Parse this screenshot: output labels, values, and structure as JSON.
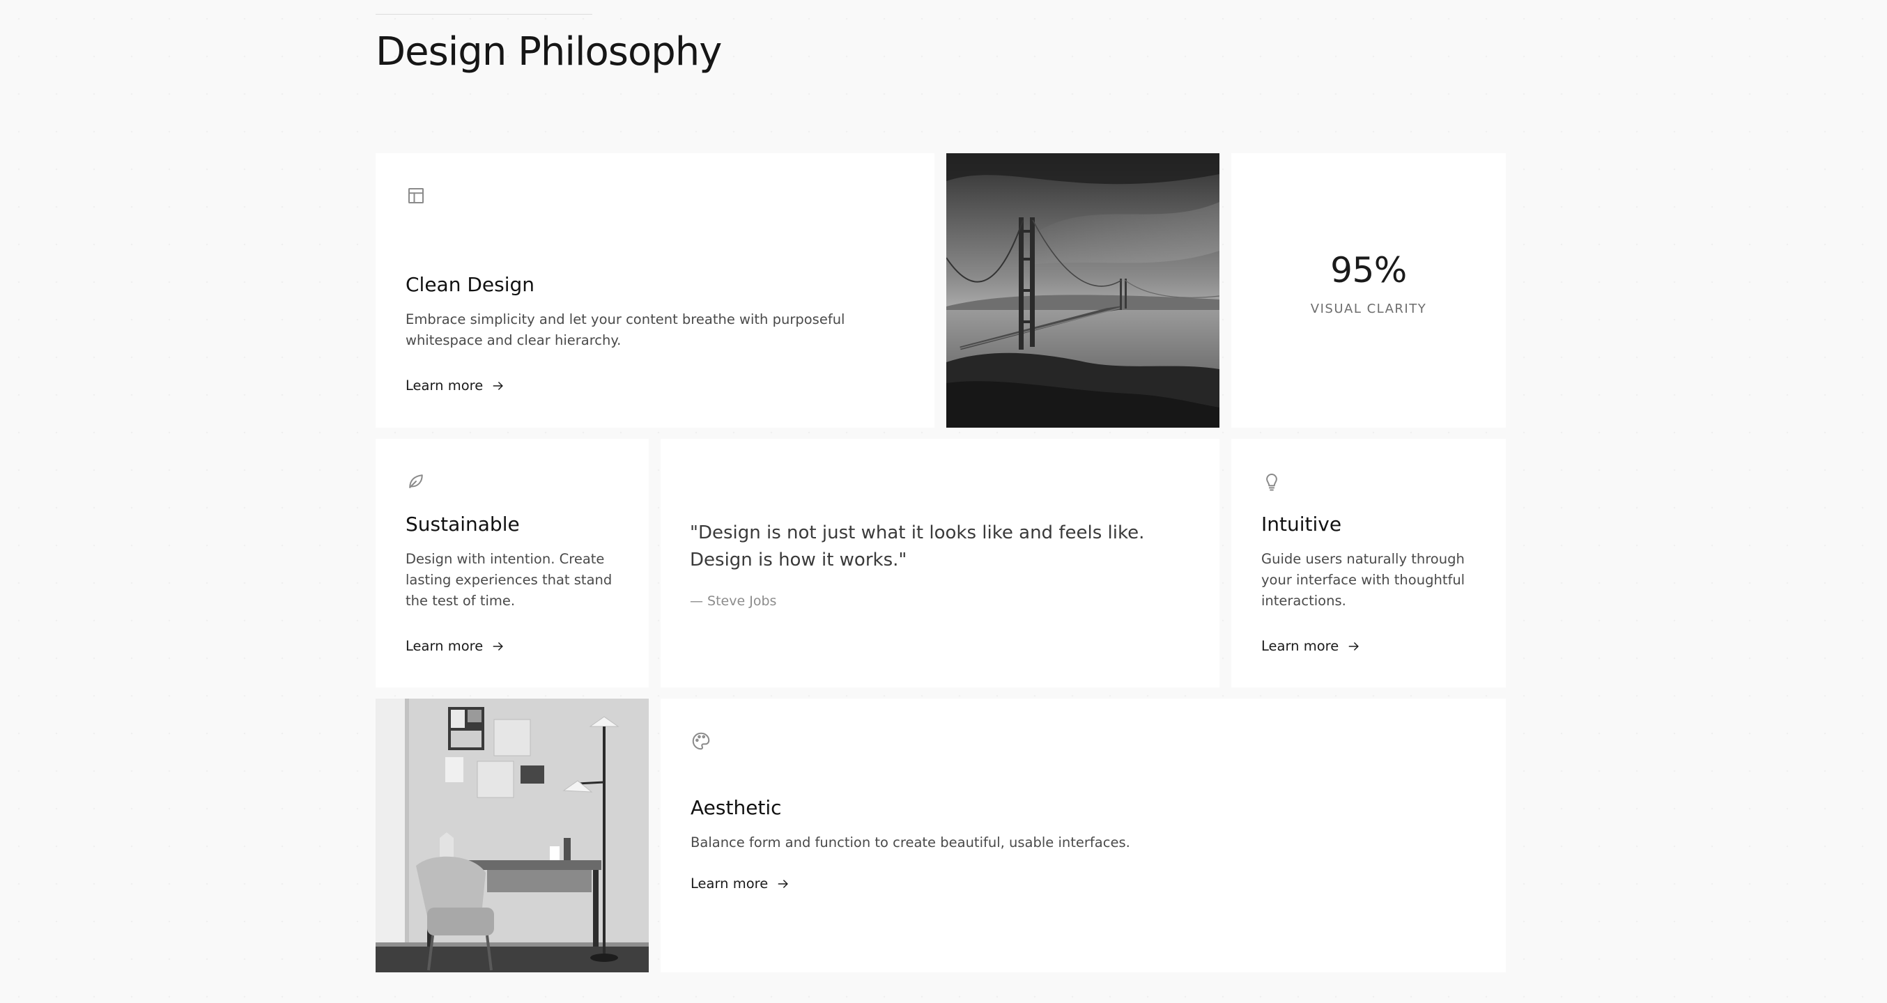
{
  "page": {
    "title": "Design Philosophy"
  },
  "cards": {
    "clean_design": {
      "icon": "layout-icon",
      "title": "Clean Design",
      "description": "Embrace simplicity and let your content breathe with purposeful whitespace and clear hierarchy.",
      "link_label": "Learn more"
    },
    "bridge_photo": {
      "description": "Golden Gate bridge black and white photo"
    },
    "stat": {
      "value": "95%",
      "label": "VISUAL CLARITY"
    },
    "sustainable": {
      "icon": "leaf-icon",
      "title": "Sustainable",
      "description": "Design with intention. Create lasting experiences that stand the test of time.",
      "link_label": "Learn more"
    },
    "quote": {
      "text": "\"Design is not just what it looks like and feels like. Design is how it works.\"",
      "author": "— Steve Jobs"
    },
    "intuitive": {
      "icon": "lightbulb-icon",
      "title": "Intuitive",
      "description": "Guide users naturally through your interface with thoughtful interactions.",
      "link_label": "Learn more"
    },
    "workspace_photo": {
      "description": "Minimal desk workspace with chair and floor lamp photo"
    },
    "aesthetic": {
      "icon": "palette-icon",
      "title": "Aesthetic",
      "description": "Balance form and function to create beautiful, usable interfaces.",
      "link_label": "Learn more"
    }
  }
}
